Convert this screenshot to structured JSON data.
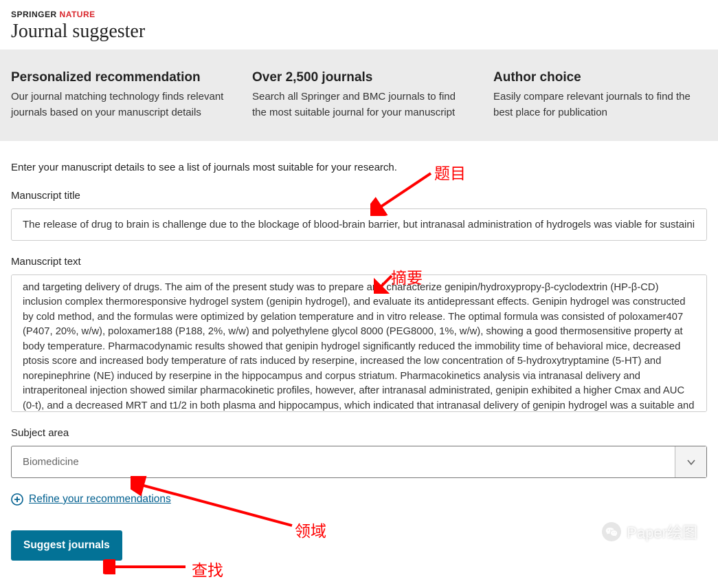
{
  "brand": {
    "left": "SPRINGER",
    "right": " NATURE"
  },
  "site_title": "Journal suggester",
  "features": [
    {
      "title": "Personalized recommendation",
      "desc": "Our journal matching technology finds relevant journals based on your manuscript details"
    },
    {
      "title": "Over 2,500 journals",
      "desc": "Search all Springer and BMC journals to find the most suitable journal for your manuscript"
    },
    {
      "title": "Author choice",
      "desc": "Easily compare relevant journals to find the best place for publication"
    }
  ],
  "intro": "Enter your manuscript details to see a list of journals most suitable for your research.",
  "fields": {
    "title_label": "Manuscript title",
    "title_value": "The release of drug to brain is challenge due to the blockage of blood-brain barrier, but intranasal administration of hydrogels was viable for sustaining and t",
    "text_label": "Manuscript text",
    "text_value": "and targeting delivery of drugs. The aim of the present study was to prepare and characterize genipin/hydroxypropy-β-cyclodextrin (HP-β-CD) inclusion complex thermoresponsive hydrogel system (genipin hydrogel), and evaluate its antidepressant effects. Genipin hydrogel was constructed by cold method, and the formulas were optimized by gelation temperature and in vitro release. The optimal formula was consisted of poloxamer407 (P407, 20%, w/w), poloxamer188 (P188, 2%, w/w) and polyethylene glycol 8000 (PEG8000, 1%, w/w), showing a good thermosensitive property at body temperature. Pharmacodynamic results showed that genipin hydrogel significantly reduced the immobility time of behavioral mice, decreased ptosis score and increased body temperature of rats induced by reserpine, increased the low concentration of 5-hydroxytryptamine (5-HT) and norepinephrine (NE) induced by reserpine in the hippocampus and corpus striatum. Pharmacokinetics analysis via intranasal delivery and intraperitoneal injection showed similar pharmacokinetic profiles, however, after intranasal administrated, genipin exhibited a higher Cmax and AUC (0-t), and a decreased MRT and t1/2 in both plasma and hippocampus, which indicated that intranasal delivery of genipin hydrogel was a suitable and promising alternative route to enhance the brain-target release of drug. In vivo fluorescence distribution also showed thermosensitive hydrogel system continuously released drug in a longer time. In a word, all results demonstrated that intranasal delivery of genipin hydrogel was a promising way for enhancing the brain targeting release and bioavailability of genipin, attaining an antidepressant effect on depressive disorder.",
    "subject_label": "Subject area",
    "subject_value": "Biomedicine"
  },
  "refine_label": "Refine your recommendations",
  "submit_label": "Suggest journals",
  "annotations": {
    "title": "题目",
    "abstract": "摘要",
    "subject": "领域",
    "search": "查找"
  },
  "watermark": "Paper绘图",
  "colors": {
    "brand_accent": "#d9242a",
    "link": "#005f8f",
    "button_bg": "#037296",
    "annotation": "#ff0000"
  }
}
